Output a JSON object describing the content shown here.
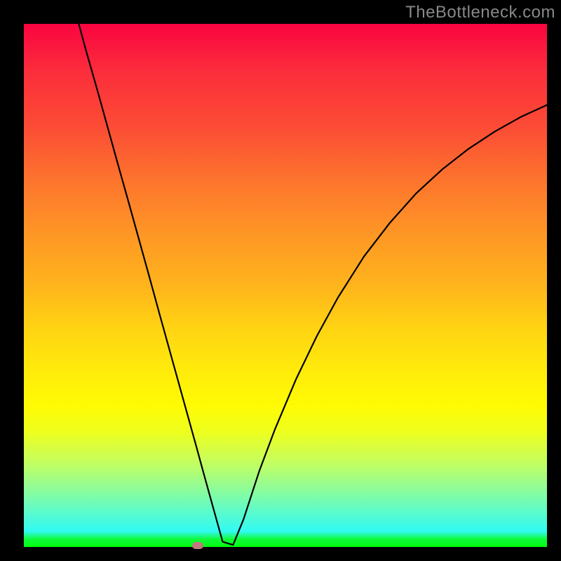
{
  "watermark": "TheBottleneck.com",
  "chart_data": {
    "type": "line",
    "title": "",
    "xlabel": "",
    "ylabel": "",
    "xlim": [
      0,
      100
    ],
    "ylim": [
      0,
      100
    ],
    "x": [
      10.5,
      12,
      14,
      16,
      18,
      20,
      22,
      24,
      26,
      28,
      30,
      31,
      32,
      33,
      33.6,
      34.2,
      35,
      36,
      38,
      40,
      42,
      45,
      48,
      52,
      56,
      60,
      65,
      70,
      75,
      80,
      85,
      90,
      95,
      100
    ],
    "values": [
      100,
      94.5,
      87.5,
      80.3,
      73.1,
      66,
      58.8,
      51.6,
      44.3,
      37.1,
      29.9,
      26.3,
      22.7,
      19.1,
      16.9,
      14.7,
      11.8,
      8.2,
      1,
      0.4,
      5.3,
      14.5,
      22.5,
      32,
      40.3,
      47.6,
      55.5,
      62,
      67.6,
      72.2,
      76.1,
      79.4,
      82.2,
      84.5
    ],
    "marker": {
      "x": 33.3,
      "y": 0.3
    },
    "grid": false,
    "legend": false
  },
  "colors": {
    "gradient_top": "#fa0440",
    "gradient_bottom": "#01fc0c",
    "curve": "#000000",
    "frame": "#000000",
    "marker": "#c07b7c",
    "watermark": "#87888a"
  }
}
